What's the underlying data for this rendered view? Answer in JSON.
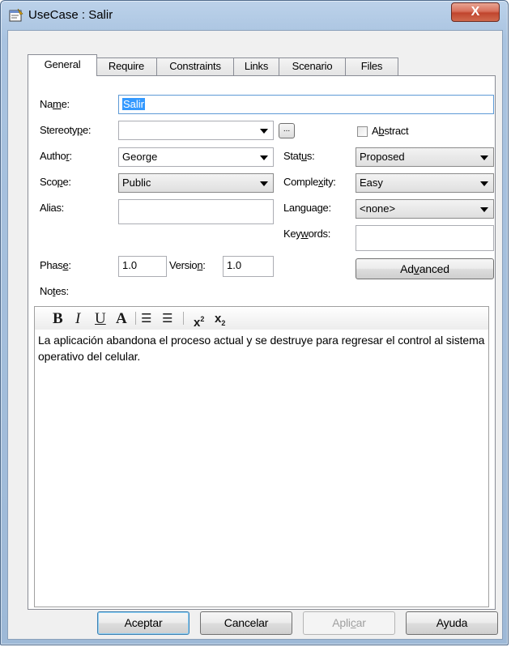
{
  "window": {
    "title": "UseCase : Salir",
    "close_glyph": "X",
    "icon": "usecase-window-icon"
  },
  "tabs": [
    {
      "label": "General",
      "active": true
    },
    {
      "label": "Require",
      "active": false
    },
    {
      "label": "Constraints",
      "active": false
    },
    {
      "label": "Links",
      "active": false
    },
    {
      "label": "Scenario",
      "active": false
    },
    {
      "label": "Files",
      "active": false
    }
  ],
  "form": {
    "name": {
      "label_pre": "Na",
      "label_key": "m",
      "label_post": "e:",
      "value": "Salir"
    },
    "stereotype": {
      "label_pre": "Stereoty",
      "label_key": "p",
      "label_post": "e:",
      "value": "",
      "browse_label": "..."
    },
    "abstract": {
      "label_pre": "A",
      "label_key": "b",
      "label_post": "stract",
      "checked": false
    },
    "author": {
      "label_pre": "Autho",
      "label_key": "r",
      "label_post": ":",
      "value": "George"
    },
    "status": {
      "label_pre": "Stat",
      "label_key": "u",
      "label_post": "s:",
      "value": "Proposed"
    },
    "scope": {
      "label_pre": "Sco",
      "label_key": "p",
      "label_post": "e:",
      "value": "Public"
    },
    "complexity": {
      "label_pre": "Comple",
      "label_key": "x",
      "label_post": "ity:",
      "value": "Easy"
    },
    "alias": {
      "label": "Alias:",
      "value": ""
    },
    "language": {
      "label": "Language:",
      "value": "<none>"
    },
    "keywords": {
      "label_pre": "Key",
      "label_key": "w",
      "label_post": "ords:",
      "value": ""
    },
    "phase": {
      "label_pre": "Phas",
      "label_key": "e",
      "label_post": ":",
      "value": "1.0"
    },
    "version": {
      "label_pre": "Versio",
      "label_key": "n",
      "label_post": ":",
      "value": "1.0"
    },
    "advanced": {
      "label_pre": "Ad",
      "label_key": "v",
      "label_post": "anced"
    },
    "notes_label": {
      "label_pre": "No",
      "label_key": "t",
      "label_post": "es:"
    }
  },
  "notes_toolbar": {
    "bold": "B",
    "italic": "I",
    "underline": "U",
    "font_color": "A",
    "bullets": "☰",
    "numbering": "☰",
    "superscript": "x",
    "superscript_mark": "2",
    "subscript": "x",
    "subscript_mark": "2"
  },
  "notes_text": "La aplicación abandona el proceso actual y se destruye para regresar el control al sistema operativo del celular.",
  "footer": {
    "accept": "Aceptar",
    "cancel": "Cancelar",
    "apply_pre": "Apli",
    "apply_key": "c",
    "apply_post": "ar",
    "help": "Ayuda"
  }
}
